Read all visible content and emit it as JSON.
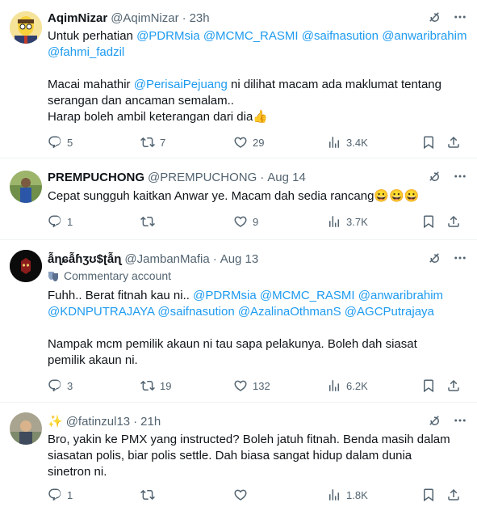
{
  "tweets": [
    {
      "name": "AqimNizar",
      "handle": "@AqimNizar",
      "time": "23h",
      "community_note": "",
      "lines": [
        [
          "Untuk perhatian ",
          "@PDRMsia",
          " ",
          "@MCMC_RASMI",
          " ",
          "@saifnasution",
          " ",
          "@anwaribrahim"
        ],
        [
          "",
          "@fahmi_fadzil"
        ],
        [
          ""
        ],
        [
          "Macai mahathir ",
          "@PerisaiPejuang",
          " ni dilihat macam ada maklumat tentang"
        ],
        [
          "serangan dan ancaman semalam.."
        ],
        [
          "Harap boleh ambil keterangan dari dia👍"
        ]
      ],
      "replies": "5",
      "retweets": "7",
      "likes": "29",
      "views": "3.4K"
    },
    {
      "name": "PREMPUCHONG",
      "handle": "@PREMPUCHONG",
      "time": "Aug 14",
      "community_note": "",
      "lines": [
        [
          "Cepat sungguh kaitkan Anwar ye. Macam dah sedia rancang😀😀😀"
        ]
      ],
      "replies": "1",
      "retweets": "",
      "likes": "9",
      "views": "3.7K"
    },
    {
      "name": "ẫɳɕẫɦʒʊ$ʈẫɳ",
      "handle": "@JambanMafia",
      "time": "Aug 13",
      "community_note": "Commentary account",
      "lines": [
        [
          "Fuhh.. Berat fitnah kau ni.. ",
          "@PDRMsia",
          " ",
          "@MCMC_RASMI",
          " ",
          "@anwaribrahim"
        ],
        [
          "",
          "@KDNPUTRAJAYA",
          " ",
          "@saifnasution",
          " ",
          "@AzalinaOthmanS",
          " ",
          "@AGCPutrajaya"
        ],
        [
          ""
        ],
        [
          "Nampak mcm pemilik akaun ni tau sapa pelakunya. Boleh dah siasat"
        ],
        [
          "pemilik akaun ni."
        ]
      ],
      "replies": "3",
      "retweets": "19",
      "likes": "132",
      "views": "6.2K"
    },
    {
      "name": "✨",
      "handle": "@fatinzul13",
      "time": "21h",
      "community_note": "",
      "lines": [
        [
          "Bro, yakin ke PMX yang instructed? Boleh jatuh fitnah. Benda masih dalam"
        ],
        [
          "siasatan polis, biar polis settle. Dah biasa sangat hidup dalam dunia"
        ],
        [
          "sinetron ni."
        ]
      ],
      "replies": "1",
      "retweets": "",
      "likes": "",
      "views": "1.8K"
    }
  ],
  "colors": {
    "text": "#0f1419",
    "secondary": "#536471",
    "link": "#1d9bf0",
    "divider": "#eff3f4"
  },
  "icons": [
    "reply-icon",
    "retweet-icon",
    "like-icon",
    "views-icon",
    "bookmark-icon",
    "share-icon",
    "grok-icon",
    "more-icon"
  ]
}
